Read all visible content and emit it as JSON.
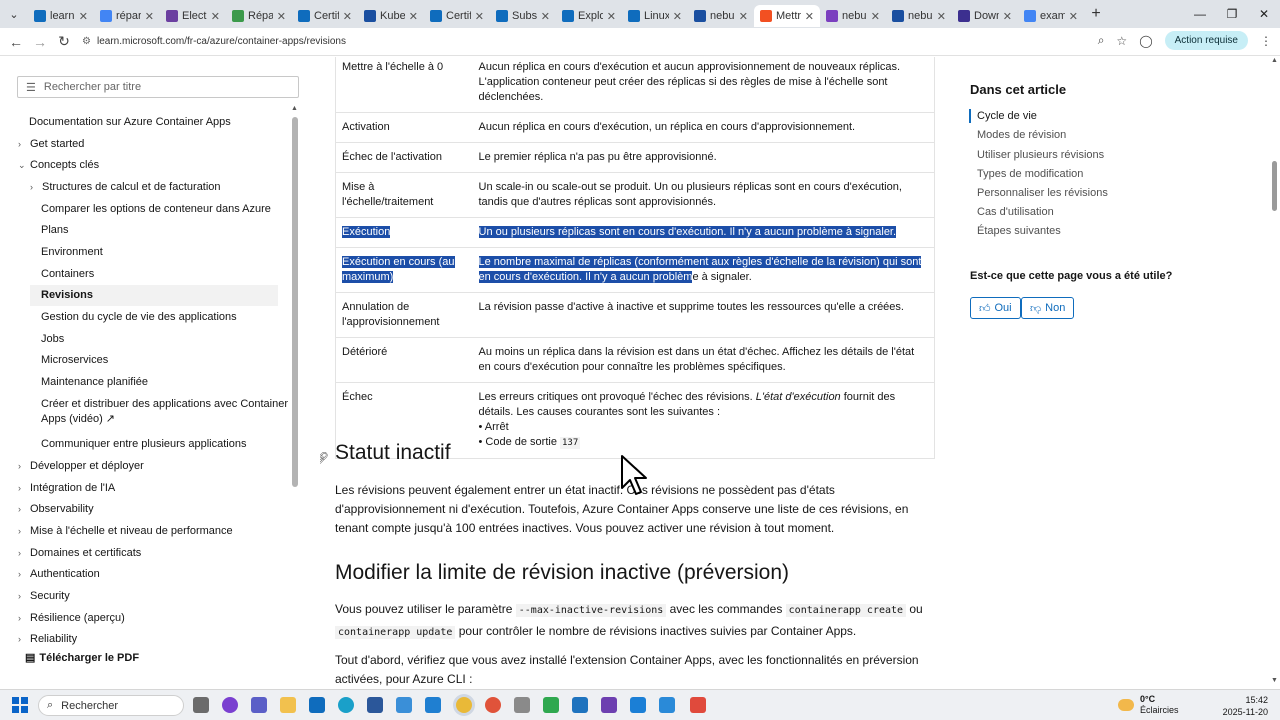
{
  "browser": {
    "tabs": [
      {
        "label": "learn",
        "color": "#0f6cbd",
        "active": false
      },
      {
        "label": "répara",
        "color": "#4285f4",
        "active": false
      },
      {
        "label": "Electr",
        "color": "#6b3fa0",
        "active": false
      },
      {
        "label": "Répar",
        "color": "#3c9a4b",
        "active": false
      },
      {
        "label": "Certif",
        "color": "#0f6cbd",
        "active": false
      },
      {
        "label": "Kuber",
        "color": "#1a4fa0",
        "active": false
      },
      {
        "label": "Certif",
        "color": "#0f6cbd",
        "active": false
      },
      {
        "label": "Subsc",
        "color": "#0f6cbd",
        "active": false
      },
      {
        "label": "Explo",
        "color": "#0f6cbd",
        "active": false
      },
      {
        "label": "Linux",
        "color": "#0f6cbd",
        "active": false
      },
      {
        "label": "nebul",
        "color": "#1a4fa0",
        "active": false
      },
      {
        "label": "Mettr",
        "color": "#f25022",
        "active": true
      },
      {
        "label": "nebul",
        "color": "#7b3fbf",
        "active": false
      },
      {
        "label": "nebul",
        "color": "#1a4fa0",
        "active": false
      },
      {
        "label": "Down",
        "color": "#3c2f8f",
        "active": false
      },
      {
        "label": "exam",
        "color": "#4285f4",
        "active": false
      }
    ],
    "url": "learn.microsoft.com/fr-ca/azure/container-apps/revisions",
    "action_required": "Action requise"
  },
  "sidebar": {
    "search_placeholder": "Rechercher par titre",
    "items": [
      {
        "label": "Documentation sur Azure Container Apps",
        "level": 0,
        "chevron": ""
      },
      {
        "label": "Get started",
        "level": 0,
        "chevron": "›"
      },
      {
        "label": "Concepts clés",
        "level": 0,
        "chevron": "⌄"
      },
      {
        "label": "Structures de calcul et de facturation",
        "level": 1,
        "chevron": "›"
      },
      {
        "label": "Comparer les options de conteneur dans Azure",
        "level": 1,
        "chevron": ""
      },
      {
        "label": "Plans",
        "level": 1,
        "chevron": ""
      },
      {
        "label": "Environment",
        "level": 1,
        "chevron": ""
      },
      {
        "label": "Containers",
        "level": 1,
        "chevron": ""
      },
      {
        "label": "Revisions",
        "level": 1,
        "chevron": "",
        "active": true
      },
      {
        "label": "Gestion du cycle de vie des applications",
        "level": 1,
        "chevron": ""
      },
      {
        "label": "Jobs",
        "level": 1,
        "chevron": ""
      },
      {
        "label": "Microservices",
        "level": 1,
        "chevron": ""
      },
      {
        "label": "Maintenance planifiée",
        "level": 1,
        "chevron": ""
      },
      {
        "label": "Créer et distribuer des applications avec Container",
        "level": 1,
        "chevron": ""
      },
      {
        "label": "Apps (vidéo) ↗",
        "level": 1,
        "chevron": ""
      },
      {
        "label": "Communiquer entre plusieurs applications",
        "level": 1,
        "chevron": ""
      },
      {
        "label": "Développer et déployer",
        "level": 0,
        "chevron": "›"
      },
      {
        "label": "Intégration de l'IA",
        "level": 0,
        "chevron": "›"
      },
      {
        "label": "Observability",
        "level": 0,
        "chevron": "›"
      },
      {
        "label": "Mise à l'échelle et niveau de performance",
        "level": 0,
        "chevron": "›"
      },
      {
        "label": "Domaines et certificats",
        "level": 0,
        "chevron": "›"
      },
      {
        "label": "Authentication",
        "level": 0,
        "chevron": "›"
      },
      {
        "label": "Security",
        "level": 0,
        "chevron": "›"
      },
      {
        "label": "Résilience (aperçu)",
        "level": 0,
        "chevron": "›"
      },
      {
        "label": "Reliability",
        "level": 0,
        "chevron": "›"
      }
    ],
    "pdf_label": "Télécharger le PDF"
  },
  "table": {
    "rows": [
      {
        "state": "Mettre à l'échelle à 0",
        "desc": "Aucun réplica en cours d'exécution et aucun approvisionnement de nouveaux réplicas. L'application conteneur peut créer des réplicas si des règles de mise à l'échelle sont déclenchées."
      },
      {
        "state": "Activation",
        "desc": "Aucun réplica en cours d'exécution, un réplica en cours d'approvisionnement."
      },
      {
        "state": "Échec de l'activation",
        "desc": "Le premier réplica n'a pas pu être approvisionné."
      },
      {
        "state": "Mise à l'échelle/traitement",
        "desc": "Un scale-in ou scale-out se produit. Un ou plusieurs réplicas sont en cours d'exécution, tandis que d'autres réplicas sont approvisionnés."
      },
      {
        "state": "Exécution",
        "desc": "Un ou plusieurs réplicas sont en cours d'exécution. Il n'y a aucun problème à signaler."
      },
      {
        "state": "Exécution en cours (au maximum)",
        "desc_selected": "Le nombre maximal de réplicas (conformément aux règles d'échelle de la révision) qui sont en cours d'exécution. Il n'y a aucun problèm",
        "desc_rest": "e à signaler."
      },
      {
        "state": "Annulation de l'approvisionnement",
        "desc": "La révision passe d'active à inactive et supprime toutes les ressources qu'elle a créées."
      },
      {
        "state": "Détérioré",
        "desc": "Au moins un réplica dans la révision est dans un état d'échec. Affichez les détails de l'état en cours d'exécution pour connaître les problèmes spécifiques."
      },
      {
        "state": "Échec",
        "desc_a": "Les erreurs critiques ont provoqué l'échec des révisions. ",
        "desc_em": "L'état d'exécution",
        "desc_b": " fournit des détails. Les causes courantes sont les suivantes :",
        "bullet1": "• Arrêt",
        "bullet2": "• Code de sortie ",
        "code": "137"
      }
    ]
  },
  "section1": {
    "title": "Statut inactif",
    "para": "Les révisions peuvent également entrer un état inactif. Ces révisions ne possèdent pas d'états d'approvisionnement ni d'exécution. Toutefois, Azure Container Apps conserve une liste de ces révisions, en tenant compte jusqu'à 100 entrées inactives. Vous pouvez activer une révision à tout moment."
  },
  "section2": {
    "title": "Modifier la limite de révision inactive (préversion)",
    "p1_a": "Vous pouvez utiliser le paramètre ",
    "p1_code1": "--max-inactive-revisions",
    "p1_b": " avec les commandes ",
    "p1_code2": "containerapp create",
    "p1_c": " ou",
    "p1_code3": "containerapp update",
    "p1_d": " pour contrôler le nombre de révisions inactives suivies par Container Apps.",
    "p2": "Tout d'abord, vérifiez que vous avez installé l'extension Container Apps, avec les fonctionnalités en préversion activées, pour Azure CLI :"
  },
  "article_nav": {
    "title": "Dans cet article",
    "items": [
      "Cycle de vie",
      "Modes de révision",
      "Utiliser plusieurs révisions",
      "Types de modification",
      "Personnaliser les révisions",
      "Cas d'utilisation",
      "Étapes suivantes"
    ],
    "helpful": "Est-ce que cette page vous a été utile?",
    "yes": "Oui",
    "no": "Non"
  },
  "taskbar": {
    "search": "Rechercher",
    "temp": "0°C",
    "weather": "Éclaircies",
    "time": "15:42",
    "date": "2025-11-20"
  }
}
